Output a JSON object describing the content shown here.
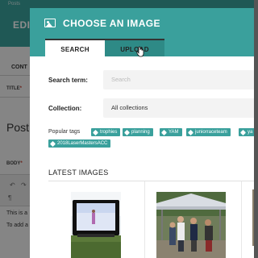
{
  "background_page": {
    "topbar_tiny": "Posts",
    "edit_label": "EDIT",
    "section_tab": "CONT",
    "title_label": "TITLE",
    "post_title": "Post",
    "body_label": "BODY",
    "body_line_1": "This is a",
    "body_line_2": "To add a"
  },
  "modal": {
    "title": "CHOOSE AN IMAGE",
    "icon": "image-icon",
    "tabs": [
      {
        "label": "SEARCH",
        "active": true
      },
      {
        "label": "UPLOAD",
        "active": false
      }
    ],
    "search_label": "Search term:",
    "search_placeholder": "Search",
    "search_value": "",
    "collection_label": "Collection:",
    "collection_value": "All collections",
    "popular_tags_label": "Popular tags",
    "tags": [
      "trophies",
      "planning",
      "YAM",
      "juniorraceteam",
      "ya",
      "2018LaserMastersACC"
    ],
    "latest_images_label": "LATEST IMAGES",
    "images": [
      {
        "name": "outdoor-movie-screen-image"
      },
      {
        "name": "tent-group-photo-image"
      }
    ]
  },
  "colors": {
    "accent": "#3aa09c",
    "accent_dark": "#2e8a86"
  }
}
